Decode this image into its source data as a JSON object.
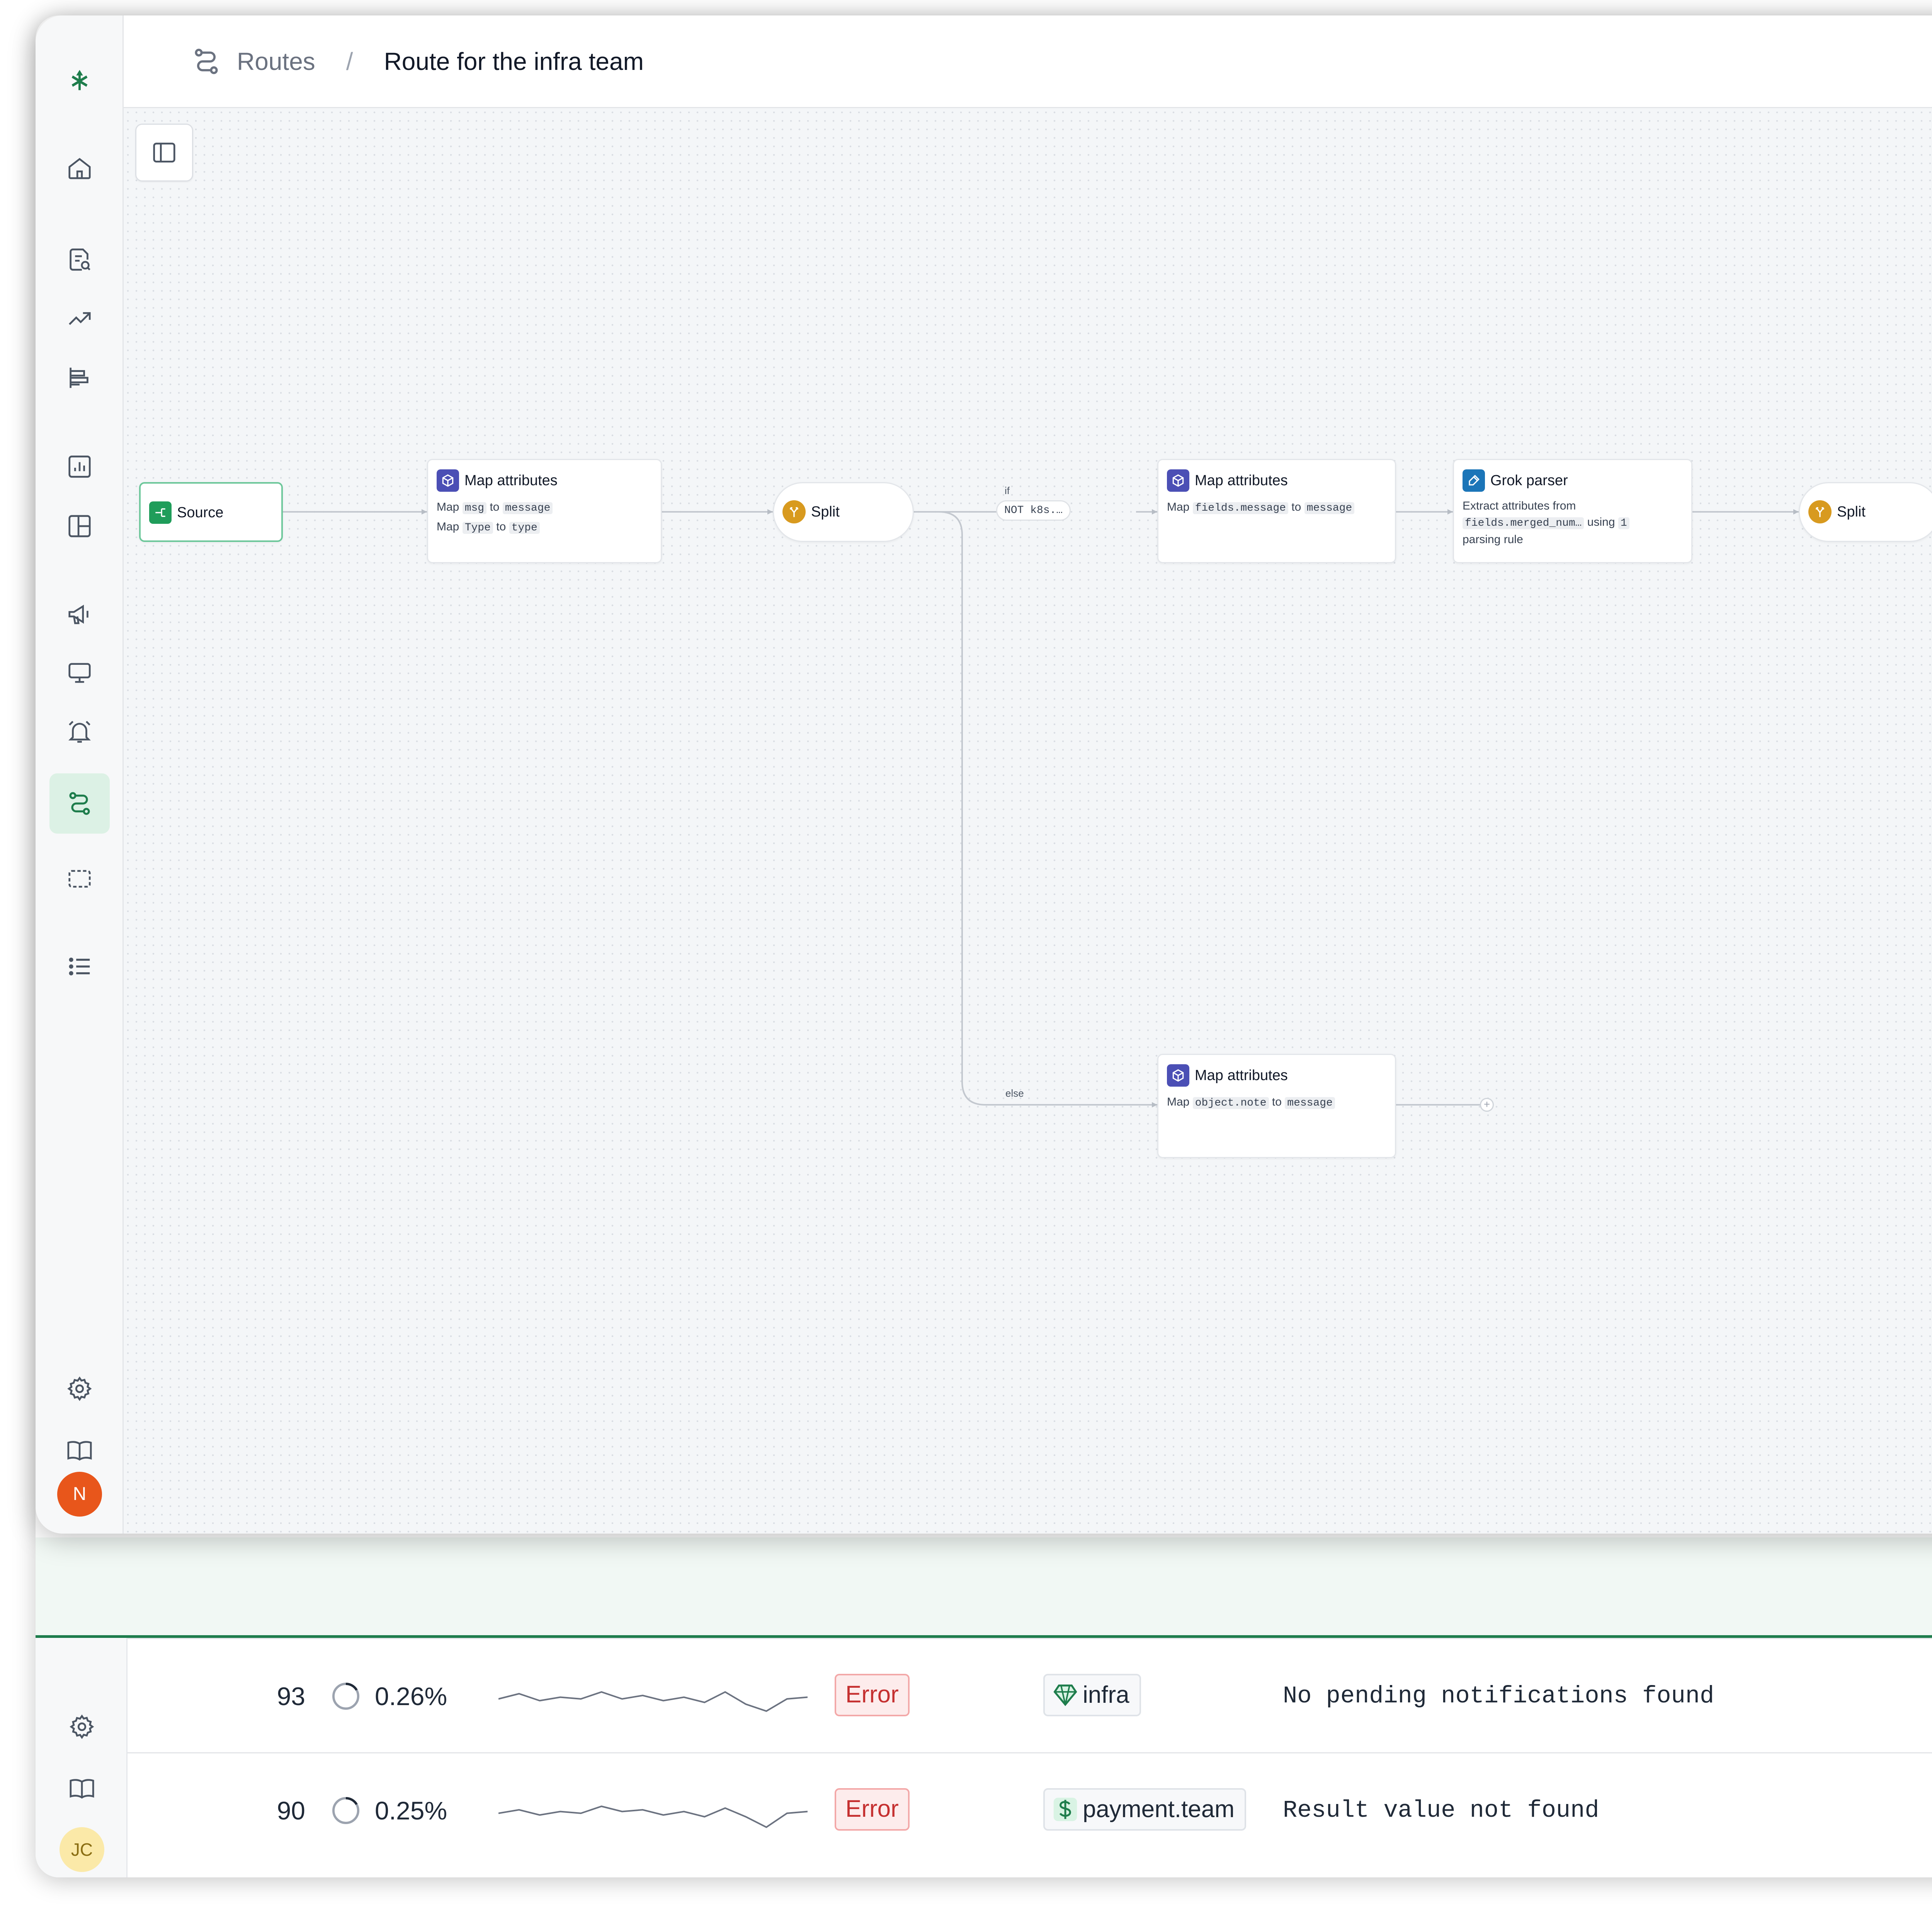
{
  "header": {
    "breadcrumb_root": "Routes",
    "breadcrumb_separator": "/",
    "breadcrumb_current": "Route for the infra team"
  },
  "sidebar": {
    "icons": [
      "logo-icon",
      "home-icon",
      "logs-search-icon",
      "trending-icon",
      "reports-icon",
      "analytics-icon",
      "dashboard-icon",
      "announcement-icon",
      "monitor-icon",
      "alerts-icon",
      "routes-icon",
      "screenshot-icon",
      "list-icon",
      "settings-icon",
      "docs-icon"
    ],
    "active_item": "routes-icon",
    "avatar_initial": "N"
  },
  "flow": {
    "source": {
      "label": "Source"
    },
    "map1": {
      "title": "Map attributes",
      "line1": {
        "prefix": "Map",
        "from": "msg",
        "mid": "to",
        "to": "message"
      },
      "line2": {
        "prefix": "Map",
        "from": "Type",
        "mid": "to",
        "to": "type"
      }
    },
    "split1": {
      "label": "Split"
    },
    "if_label": "if",
    "condition": "NOT k8s.…",
    "else_label": "else",
    "map2": {
      "title": "Map attributes",
      "line1": {
        "prefix": "Map",
        "from": "fields.message",
        "mid": "to",
        "to": "message"
      }
    },
    "grok": {
      "title": "Grok parser",
      "line1": "Extract attributes from",
      "field": "fields.merged_num…",
      "using": "using",
      "count": "1",
      "line3": "parsing rule"
    },
    "split2": {
      "label": "Split"
    },
    "map3": {
      "title": "Map attributes",
      "line1": {
        "prefix": "Map",
        "from": "object.note",
        "mid": "to",
        "to": "message"
      }
    },
    "add_symbol": "+"
  },
  "background_window": {
    "rows": [
      {
        "count": "93",
        "percent": "0.26%",
        "status": "Error",
        "team": "infra",
        "team_icon": "gem-icon",
        "message": "No pending notifications found",
        "spark": [
          0.5,
          0.35,
          0.55,
          0.45,
          0.5,
          0.3,
          0.5,
          0.4,
          0.55,
          0.45,
          0.6,
          0.3,
          0.65,
          0.85,
          0.5,
          0.45
        ]
      },
      {
        "count": "90",
        "percent": "0.25%",
        "status": "Error",
        "team": "payment.team",
        "team_icon": "dollar-icon",
        "message": "Result value not found",
        "spark": [
          0.5,
          0.4,
          0.55,
          0.45,
          0.5,
          0.3,
          0.45,
          0.4,
          0.55,
          0.45,
          0.6,
          0.35,
          0.6,
          0.9,
          0.5,
          0.45
        ]
      }
    ],
    "avatar_initials": "JC",
    "status_color": "#c53030",
    "accent_color": "#1e7d4c"
  }
}
